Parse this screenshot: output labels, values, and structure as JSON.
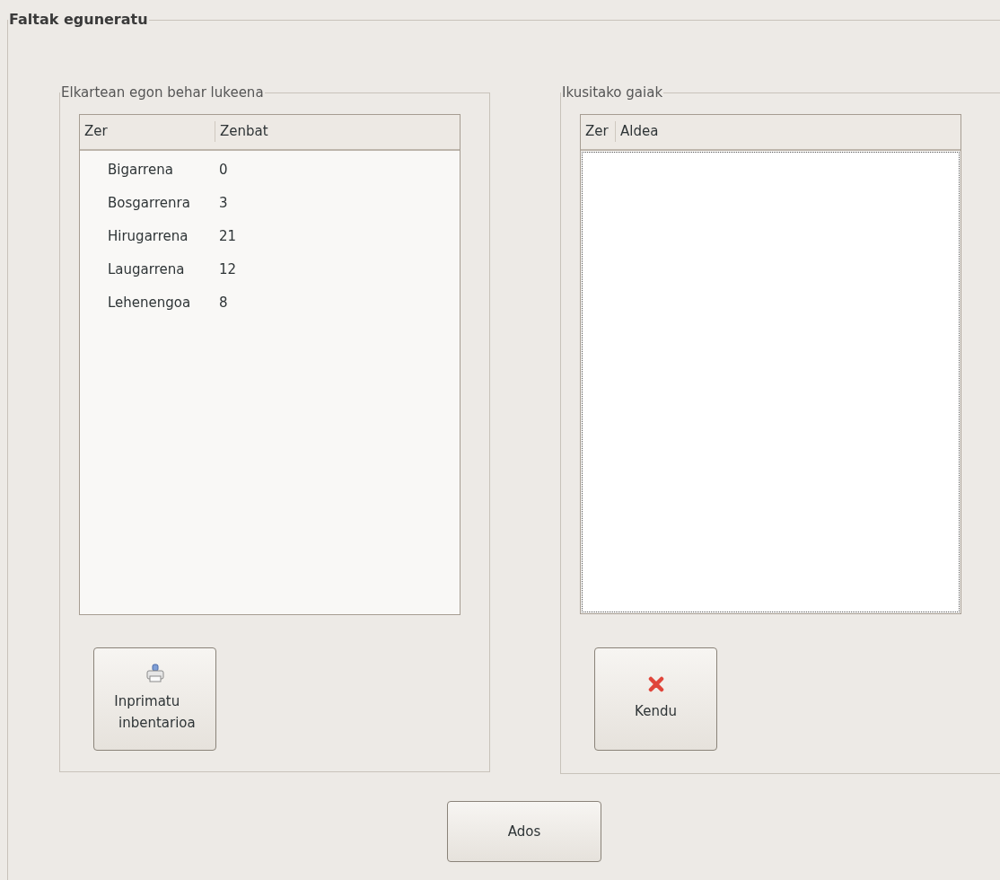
{
  "window": {
    "title": "Faltak eguneratu"
  },
  "left_group": {
    "title": "Elkartean egon behar lukeena",
    "table": {
      "columns": [
        "Zer",
        "Zenbat"
      ],
      "rows": [
        [
          "Bigarrena",
          "0"
        ],
        [
          "Bosgarrenra",
          "3"
        ],
        [
          "Hirugarrena",
          "21"
        ],
        [
          "Laugarrena",
          "12"
        ],
        [
          "Lehenengoa",
          "8"
        ]
      ]
    },
    "button": {
      "label": "Inprimatu\n inbentarioa"
    }
  },
  "right_group": {
    "title": "Ikusitako gaiak",
    "table": {
      "columns": [
        "Zer",
        "Aldea"
      ]
    },
    "button": {
      "label": "Kendu"
    }
  },
  "ok_button": {
    "label": "Ados"
  }
}
